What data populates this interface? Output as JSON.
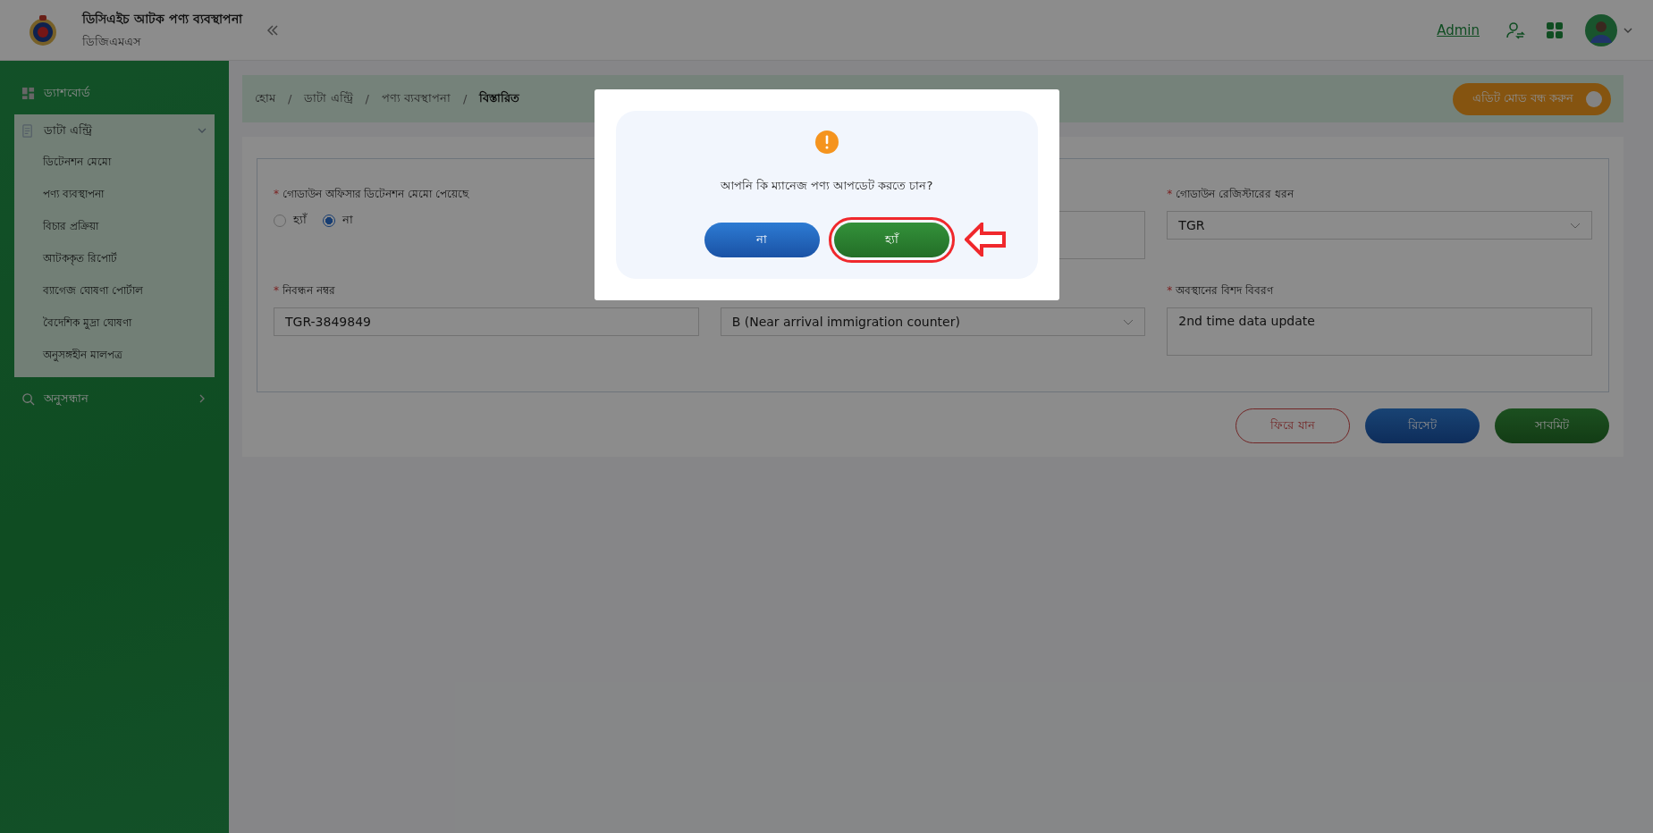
{
  "header": {
    "title": "ডিসিএইচ আটক পণ্য ব্যবস্থাপনা",
    "subtitle": "ডিজিএমএস",
    "user": "Admin"
  },
  "sidebar": {
    "items": [
      {
        "kind": "dashboard",
        "label": "ড্যাশবোর্ড"
      },
      {
        "kind": "data-entry",
        "label": "ডাটা এন্ট্রি",
        "expanded": true,
        "children": [
          {
            "label": "ডিটেনশন মেমো"
          },
          {
            "label": "পণ্য ব্যবস্থাপনা"
          },
          {
            "label": "বিচার প্রক্রিয়া"
          },
          {
            "label": "আটককৃত রিপোর্ট"
          },
          {
            "label": "ব্যাগেজ ঘোষণা পোর্টাল"
          },
          {
            "label": "বৈদেশিক মুদ্রা ঘোষণা"
          },
          {
            "label": "অনুসঙ্গহীন মালপত্র"
          }
        ]
      },
      {
        "kind": "search",
        "label": "অনুসন্ধান",
        "expanded": false
      }
    ]
  },
  "breadcrumbs": [
    {
      "label": "হোম",
      "current": false
    },
    {
      "label": "ডাটা এন্ট্রি",
      "current": false
    },
    {
      "label": "পণ্য ব্যবস্থাপনা",
      "current": false
    },
    {
      "label": "বিস্তারিত",
      "current": true
    }
  ],
  "separator": "/",
  "edit_mode": {
    "label": "এডিট মোড বন্ধ করুন",
    "on": true
  },
  "form": {
    "fields": [
      {
        "kind": "radio",
        "required_mark": "*",
        "label": "গোডাউন অফিসার ডিটেনশন মেমো পেয়েছে",
        "options": [
          {
            "label": "হ্যাঁ",
            "selected": false
          },
          {
            "label": "না",
            "selected": true
          }
        ]
      },
      {
        "kind": "textarea"
      },
      {
        "kind": "select",
        "required_mark": "*",
        "label": "গোডাউন রেজিস্টারের ধরন",
        "value": "TGR"
      },
      {
        "kind": "input",
        "required_mark": "*",
        "label": "নিবন্ধন নম্বর",
        "value": "TGR-3849849"
      },
      {
        "kind": "select",
        "value": "B (Near arrival immigration counter)"
      },
      {
        "kind": "textarea",
        "required_mark": "*",
        "label": "অবস্থানের বিশদ বিবরণ",
        "value": "2nd time data update"
      }
    ],
    "buttons": [
      {
        "kind": "back",
        "label": "ফিরে যান"
      },
      {
        "kind": "reset",
        "label": "রিসেট"
      },
      {
        "kind": "submit",
        "label": "সাবমিট"
      }
    ]
  },
  "modal": {
    "message": "আপনি কি ম্যানেজ পণ্য আপডেট করতে চান?",
    "buttons": [
      {
        "kind": "cancel",
        "label": "না",
        "highlighted": false
      },
      {
        "kind": "confirm",
        "label": "হ্যাঁ",
        "highlighted": true
      }
    ]
  }
}
